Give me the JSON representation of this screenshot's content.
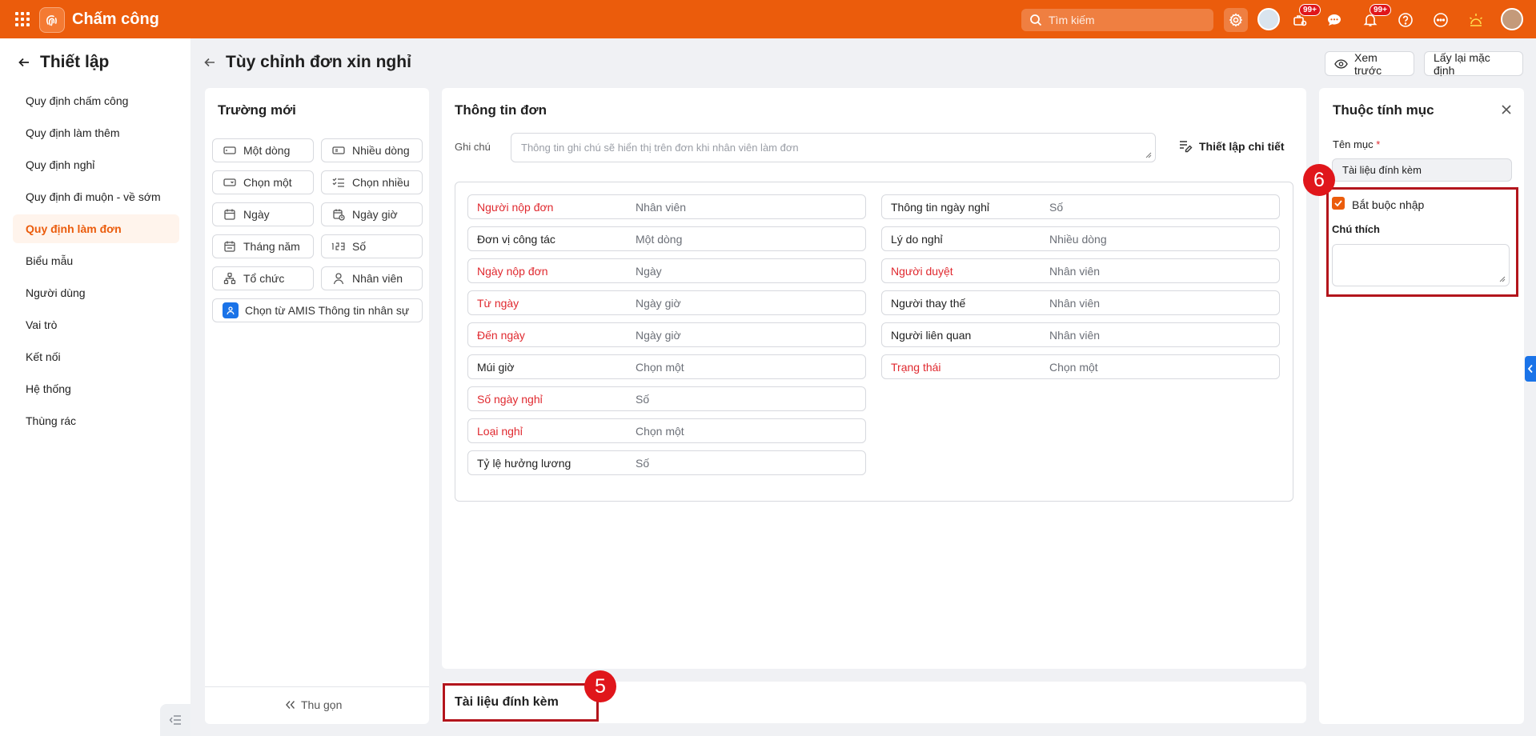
{
  "app": {
    "title": "Chấm công",
    "search_placeholder": "Tìm kiếm",
    "badges": {
      "tasks": "99+",
      "notifications": "99+"
    }
  },
  "sidebar": {
    "title": "Thiết lập",
    "items": [
      {
        "label": "Quy định chấm công"
      },
      {
        "label": "Quy định làm thêm"
      },
      {
        "label": "Quy định nghỉ"
      },
      {
        "label": "Quy định đi muộn - về sớm"
      },
      {
        "label": "Quy định làm đơn",
        "active": true
      },
      {
        "label": "Biểu mẫu"
      },
      {
        "label": "Người dùng"
      },
      {
        "label": "Vai trò"
      },
      {
        "label": "Kết nối"
      },
      {
        "label": "Hệ thống"
      },
      {
        "label": "Thùng rác"
      }
    ]
  },
  "page": {
    "title": "Tùy chỉnh đơn xin nghỉ",
    "preview_label": "Xem trước",
    "reset_label": "Lấy lại mặc định"
  },
  "new_fields": {
    "title": "Trường mới",
    "items": [
      {
        "label": "Một dòng",
        "icon": "single-line-icon"
      },
      {
        "label": "Nhiều dòng",
        "icon": "multi-line-icon"
      },
      {
        "label": "Chọn một",
        "icon": "select-one-icon"
      },
      {
        "label": "Chọn nhiều",
        "icon": "select-many-icon"
      },
      {
        "label": "Ngày",
        "icon": "calendar-icon"
      },
      {
        "label": "Ngày giờ",
        "icon": "calendar-clock-icon"
      },
      {
        "label": "Tháng năm",
        "icon": "month-year-icon"
      },
      {
        "label": "Số",
        "icon": "number-icon"
      },
      {
        "label": "Tổ chức",
        "icon": "org-icon"
      },
      {
        "label": "Nhân viên",
        "icon": "person-icon"
      },
      {
        "label": "Chọn từ AMIS Thông tin nhân sự",
        "icon": "amis-icon"
      }
    ],
    "collapse_label": "Thu gọn"
  },
  "form": {
    "title": "Thông tin đơn",
    "note_label": "Ghi chú",
    "note_placeholder": "Thông tin ghi chú sẽ hiển thị trên đơn khi nhân viên làm đơn",
    "setup_detail_label": "Thiết lập chi tiết",
    "left_rows": [
      {
        "label": "Người nộp đơn",
        "type": "Nhân viên",
        "required": true
      },
      {
        "label": "Đơn vị công tác",
        "type": "Một dòng",
        "required": false
      },
      {
        "label": "Ngày nộp đơn",
        "type": "Ngày",
        "required": true
      },
      {
        "label": "Từ ngày",
        "type": "Ngày giờ",
        "required": true
      },
      {
        "label": "Đến ngày",
        "type": "Ngày giờ",
        "required": true
      },
      {
        "label": "Múi giờ",
        "type": "Chọn một",
        "required": false
      },
      {
        "label": "Số ngày nghỉ",
        "type": "Số",
        "required": true
      },
      {
        "label": "Loại nghỉ",
        "type": "Chọn một",
        "required": true
      },
      {
        "label": "Tỷ lệ hưởng lương",
        "type": "Số",
        "required": false
      }
    ],
    "right_rows": [
      {
        "label": "Thông tin ngày nghỉ",
        "type": "Số",
        "required": false
      },
      {
        "label": "Lý do nghỉ",
        "type": "Nhiều dòng",
        "required": false
      },
      {
        "label": "Người duyệt",
        "type": "Nhân viên",
        "required": true
      },
      {
        "label": "Người thay thế",
        "type": "Nhân viên",
        "required": false
      },
      {
        "label": "Người liên quan",
        "type": "Nhân viên",
        "required": false
      },
      {
        "label": "Trạng thái",
        "type": "Chọn một",
        "required": true
      }
    ]
  },
  "attachments": {
    "title": "Tài liệu đính kèm",
    "marker": "5"
  },
  "properties": {
    "title": "Thuộc tính mục",
    "name_label": "Tên mục",
    "name_required_mark": "*",
    "name_value": "Tài liệu đính kèm",
    "required_label": "Bắt buộc nhập",
    "required_checked": true,
    "note_label": "Chú thích",
    "marker": "6"
  },
  "colors": {
    "brand": "#eb5c0c",
    "required": "#e0292f",
    "highlight": "#b3151c",
    "marker": "#e0161b"
  }
}
